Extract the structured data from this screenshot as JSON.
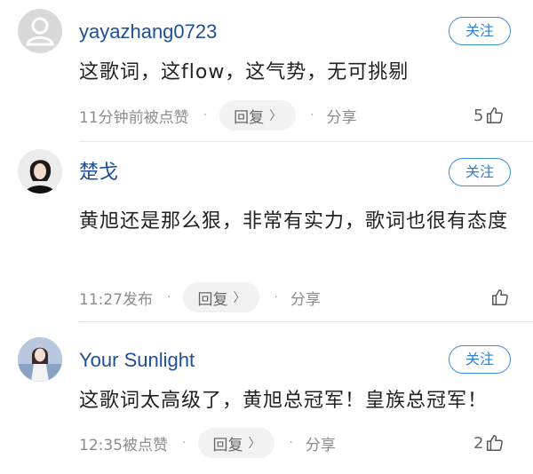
{
  "comments": [
    {
      "username": "yayazhang0723",
      "follow_label": "关注",
      "content": "这歌词，这flow，这气势，无可挑剔",
      "time": "11分钟前被点赞",
      "reply_label": "回复",
      "share_label": "分享",
      "likes": "5"
    },
    {
      "username": "楚戈",
      "follow_label": "关注",
      "content": "黄旭还是那么狠，非常有实力，歌词也很有态度",
      "time": "11:27发布",
      "reply_label": "回复",
      "share_label": "分享",
      "likes": ""
    },
    {
      "username": "Your Sunlight",
      "follow_label": "关注",
      "content": "这歌词太高级了，黄旭总冠军！皇族总冠军！",
      "time": "12:35被点赞",
      "reply_label": "回复",
      "share_label": "分享",
      "likes": "2"
    }
  ],
  "icons": {
    "like": "thumbs-up-icon",
    "chevron": "chevron-right-icon",
    "default_avatar": "user-silhouette-icon"
  },
  "colors": {
    "username": "#1f4f96",
    "follow_border": "#3c8de0",
    "meta_text": "#8c8c8c",
    "reply_bg": "#f2f2f2"
  }
}
